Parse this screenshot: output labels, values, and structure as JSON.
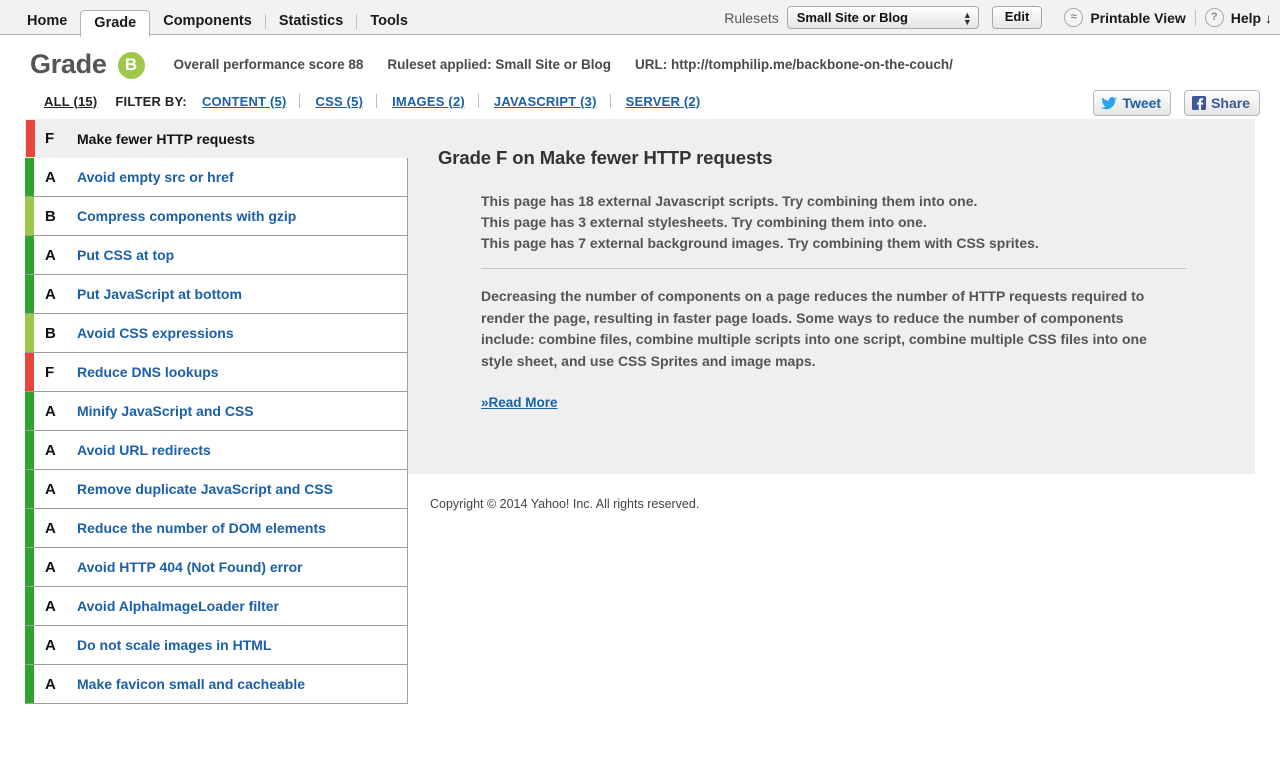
{
  "topbar": {
    "tabs": [
      {
        "label": "Home",
        "active": false
      },
      {
        "label": "Grade",
        "active": true
      },
      {
        "label": "Components",
        "active": false
      },
      {
        "label": "Statistics",
        "active": false
      },
      {
        "label": "Tools",
        "active": false
      }
    ],
    "rulesets_label": "Rulesets",
    "ruleset_selected": "Small Site or Blog",
    "edit_label": "Edit",
    "printable_view_label": "Printable View",
    "printable_view_icon": "approx-circle-icon",
    "help_label": "Help ↓",
    "help_icon": "question-circle-icon"
  },
  "grade_header": {
    "title": "Grade",
    "badge_letter": "B",
    "badge_color": "#9dc84a",
    "overall_score": "Overall performance score 88",
    "ruleset_applied": "Ruleset applied: Small Site or Blog",
    "url": "URL: http://tomphilip.me/backbone-on-the-couch/"
  },
  "filterbar": {
    "all_label": "ALL (15)",
    "filter_by_label": "FILTER BY:",
    "filters": [
      {
        "label": "CONTENT (5)"
      },
      {
        "label": "CSS (5)"
      },
      {
        "label": "IMAGES (2)"
      },
      {
        "label": "JAVASCRIPT (3)"
      },
      {
        "label": "SERVER (2)"
      }
    ],
    "tweet_label": "Tweet",
    "share_label": "Share"
  },
  "rules": [
    {
      "grade": "F",
      "label": "Make fewer HTTP requests",
      "color": "#e8453c",
      "selected": true
    },
    {
      "grade": "A",
      "label": "Avoid empty src or href",
      "color": "#2ca42f",
      "selected": false
    },
    {
      "grade": "B",
      "label": "Compress components with gzip",
      "color": "#9dc84a",
      "selected": false
    },
    {
      "grade": "A",
      "label": "Put CSS at top",
      "color": "#2ca42f",
      "selected": false
    },
    {
      "grade": "A",
      "label": "Put JavaScript at bottom",
      "color": "#2ca42f",
      "selected": false
    },
    {
      "grade": "B",
      "label": "Avoid CSS expressions",
      "color": "#9dc84a",
      "selected": false
    },
    {
      "grade": "F",
      "label": "Reduce DNS lookups",
      "color": "#e8453c",
      "selected": false
    },
    {
      "grade": "A",
      "label": "Minify JavaScript and CSS",
      "color": "#2ca42f",
      "selected": false
    },
    {
      "grade": "A",
      "label": "Avoid URL redirects",
      "color": "#2ca42f",
      "selected": false
    },
    {
      "grade": "A",
      "label": "Remove duplicate JavaScript and CSS",
      "color": "#2ca42f",
      "selected": false
    },
    {
      "grade": "A",
      "label": "Reduce the number of DOM elements",
      "color": "#2ca42f",
      "selected": false
    },
    {
      "grade": "A",
      "label": "Avoid HTTP 404 (Not Found) error",
      "color": "#2ca42f",
      "selected": false
    },
    {
      "grade": "A",
      "label": "Avoid AlphaImageLoader filter",
      "color": "#2ca42f",
      "selected": false
    },
    {
      "grade": "A",
      "label": "Do not scale images in HTML",
      "color": "#2ca42f",
      "selected": false
    },
    {
      "grade": "A",
      "label": "Make favicon small and cacheable",
      "color": "#2ca42f",
      "selected": false
    }
  ],
  "detail": {
    "title": "Grade F on Make fewer HTTP requests",
    "facts": [
      "This page has 18 external Javascript scripts. Try combining them into one.",
      "This page has 3 external stylesheets. Try combining them into one.",
      "This page has 7 external background images. Try combining them with CSS sprites."
    ],
    "body": "Decreasing the number of components on a page reduces the number of HTTP requests required to render the page, resulting in faster page loads. Some ways to reduce the number of components include: combine files, combine multiple scripts into one script, combine multiple CSS files into one style sheet, and use CSS Sprites and image maps.",
    "read_more_label": "»Read More"
  },
  "footer": {
    "copyright": "Copyright © 2014 Yahoo! Inc. All rights reserved."
  }
}
